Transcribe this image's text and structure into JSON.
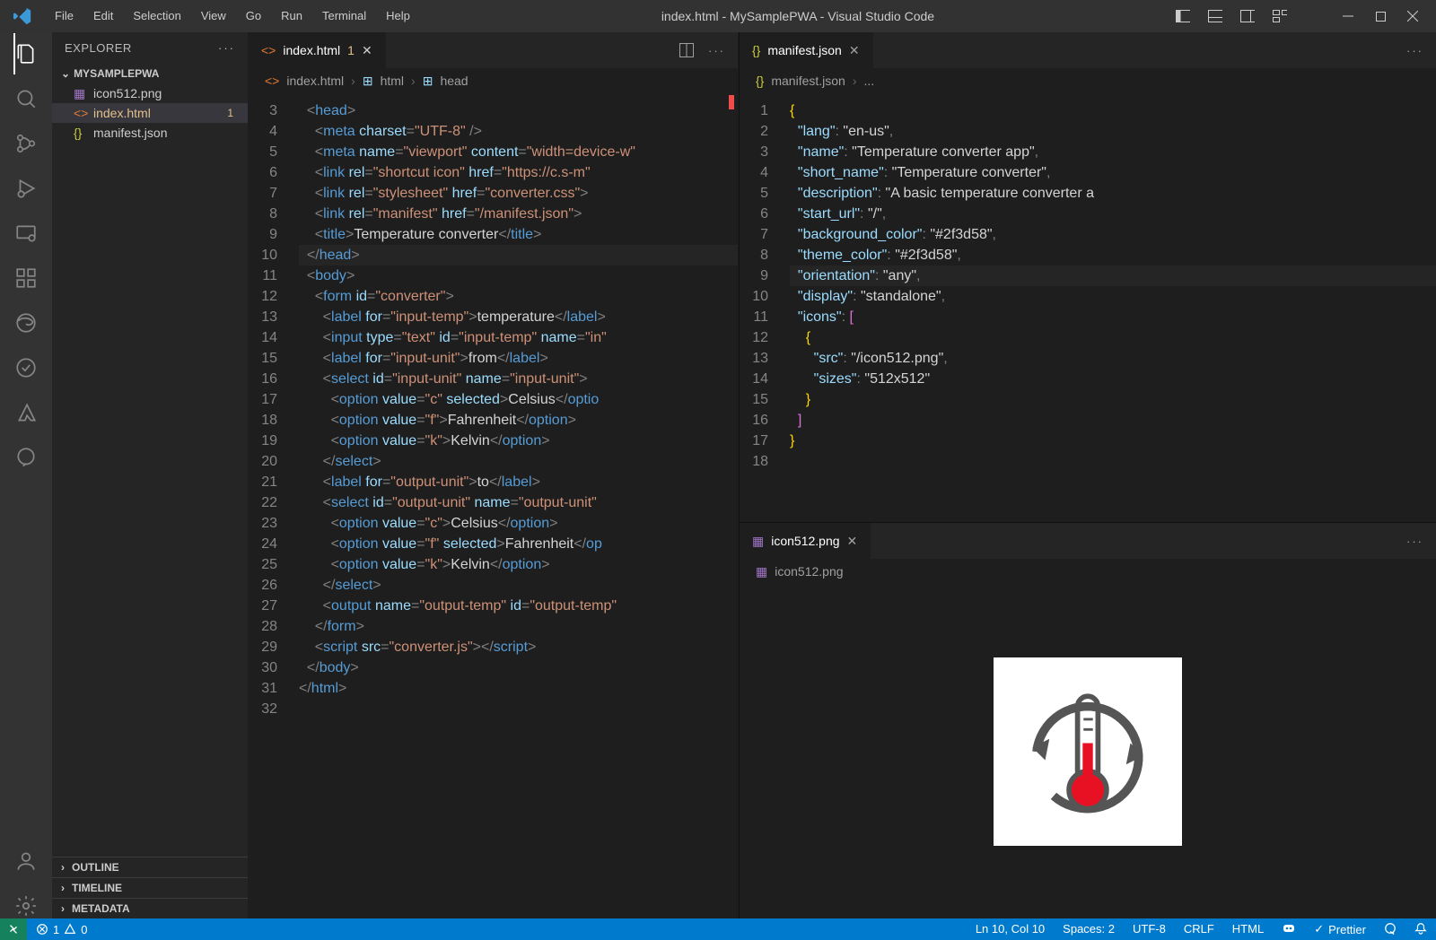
{
  "titlebar": {
    "menus": [
      "File",
      "Edit",
      "Selection",
      "View",
      "Go",
      "Run",
      "Terminal",
      "Help"
    ],
    "title": "index.html - MySamplePWA - Visual Studio Code"
  },
  "sidebar": {
    "header": "EXPLORER",
    "root": "MYSAMPLEPWA",
    "items": [
      {
        "icon": "img",
        "label": "icon512.png"
      },
      {
        "icon": "html",
        "label": "index.html",
        "modified": true,
        "badge": "1"
      },
      {
        "icon": "json",
        "label": "manifest.json"
      }
    ],
    "sections": [
      "OUTLINE",
      "TIMELINE",
      "METADATA"
    ]
  },
  "editorLeft": {
    "tab": {
      "label": "index.html",
      "modified": "1"
    },
    "breadcrumb": [
      "index.html",
      "html",
      "head"
    ],
    "startLine": 3,
    "code": [
      "  <head>",
      "    <meta charset=\"UTF-8\" />",
      "    <meta name=\"viewport\" content=\"width=device-w",
      "    <link rel=\"shortcut icon\" href=\"https://c.s-m",
      "    <link rel=\"stylesheet\" href=\"converter.css\">",
      "    <link rel=\"manifest\" href=\"/manifest.json\">",
      "    <title>Temperature converter</title>",
      "  </head>",
      "  <body>",
      "    <form id=\"converter\">",
      "      <label for=\"input-temp\">temperature</label>",
      "      <input type=\"text\" id=\"input-temp\" name=\"in",
      "      <label for=\"input-unit\">from</label>",
      "      <select id=\"input-unit\" name=\"input-unit\">",
      "        <option value=\"c\" selected>Celsius</optio",
      "        <option value=\"f\">Fahrenheit</option>",
      "        <option value=\"k\">Kelvin</option>",
      "      </select>",
      "      <label for=\"output-unit\">to</label>",
      "      <select id=\"output-unit\" name=\"output-unit\"",
      "        <option value=\"c\">Celsius</option>",
      "        <option value=\"f\" selected>Fahrenheit</op",
      "        <option value=\"k\">Kelvin</option>",
      "      </select>",
      "      <output name=\"output-temp\" id=\"output-temp\"",
      "    </form>",
      "    <script src=\"converter.js\"></script>",
      "  </body>",
      "</html>",
      ""
    ]
  },
  "editorRightTop": {
    "tab": {
      "label": "manifest.json"
    },
    "breadcrumb": [
      "manifest.json",
      "..."
    ],
    "startLine": 1,
    "jsonLines": [
      "{",
      "  \"lang\": \"en-us\",",
      "  \"name\": \"Temperature converter app\",",
      "  \"short_name\": \"Temperature converter\",",
      "  \"description\": \"A basic temperature converter a",
      "  \"start_url\": \"/\",",
      "  \"background_color\": \"#2f3d58\",",
      "  \"theme_color\": \"#2f3d58\",",
      "  \"orientation\": \"any\",",
      "  \"display\": \"standalone\",",
      "  \"icons\": [",
      "    {",
      "      \"src\": \"/icon512.png\",",
      "      \"sizes\": \"512x512\"",
      "    }",
      "  ]",
      "}",
      ""
    ]
  },
  "editorRightBottom": {
    "tab": {
      "label": "icon512.png"
    },
    "breadcrumb": "icon512.png"
  },
  "statusbar": {
    "errors": "1",
    "warnings": "0",
    "ln": "Ln 10, Col 10",
    "spaces": "Spaces: 2",
    "encoding": "UTF-8",
    "eol": "CRLF",
    "lang": "HTML",
    "prettier": "Prettier"
  }
}
